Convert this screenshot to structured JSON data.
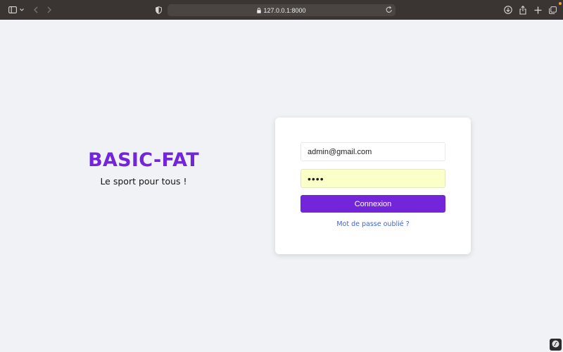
{
  "browser": {
    "url": "127.0.0.1:8000",
    "icons": [
      "sidebar-icon",
      "chevron-down-icon",
      "back-arrow-icon",
      "forward-arrow-icon",
      "shield-icon",
      "lock-icon",
      "reload-icon",
      "download-icon",
      "share-icon",
      "plus-icon",
      "tabs-overview-icon"
    ]
  },
  "brand": {
    "title": "BASIC-FAT",
    "tagline": "Le sport pour tous !"
  },
  "login": {
    "email_value": "admin@gmail.com",
    "password_value": "1234",
    "submit_label": "Connexion",
    "forgot_label": "Mot de passe oublié ?"
  },
  "colors": {
    "page_bg": "#f0f2f6",
    "brand_purple": "#7325dc",
    "button_purple": "#7326d9",
    "link_blue": "#3d63d8",
    "autofill_yellow": "#fbffc8",
    "toolbar": "#3a3533"
  }
}
